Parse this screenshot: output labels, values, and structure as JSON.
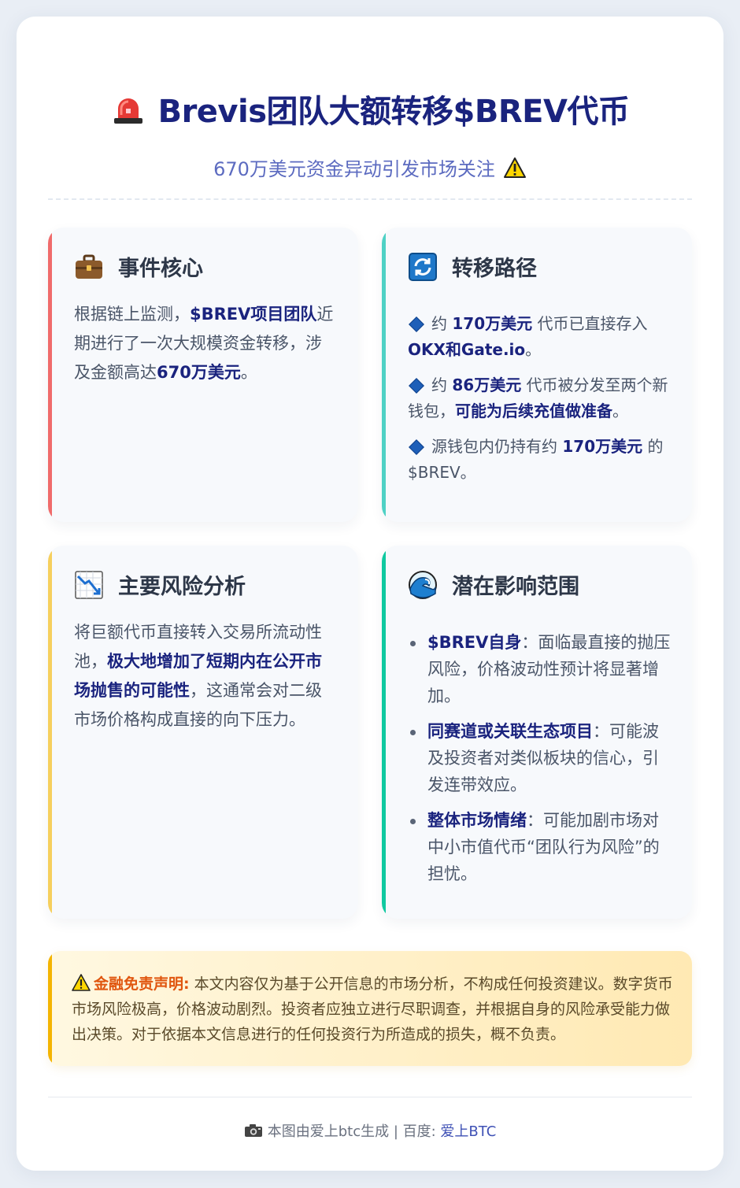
{
  "header": {
    "title": "Brevis团队大额转移$BREV代币",
    "subtitle": "670万美元资金异动引发市场关注"
  },
  "panels": {
    "core": {
      "title": "事件核心",
      "icon": "briefcase-icon",
      "body": {
        "t1": "根据链上监测，",
        "h1": "$BREV项目团队",
        "t2": "近期进行了一次大规模资金转移，涉及金额高达",
        "h2": "670万美元",
        "t3": "。"
      }
    },
    "route": {
      "title": "转移路径",
      "icon": "refresh-icon",
      "items": [
        {
          "t1": "约 ",
          "h1": "170万美元",
          "t2": " 代币已直接存入 ",
          "h2": "OKX和Gate.io",
          "t3": "。"
        },
        {
          "t1": "约 ",
          "h1": "86万美元",
          "t2": " 代币被分发至两个新钱包，",
          "h2": "可能为后续充值做准备",
          "t3": "。"
        },
        {
          "t1": "源钱包内仍持有约 ",
          "h1": "170万美元",
          "t2": " 的 $BREV。"
        }
      ]
    },
    "risk": {
      "title": "主要风险分析",
      "icon": "chart-decreasing-icon",
      "body": {
        "t1": "将巨额代币直接转入交易所流动性池，",
        "h1": "极大地增加了短期内在公开市场抛售的可能性",
        "t2": "，这通常会对二级市场价格构成直接的向下压力。"
      }
    },
    "impact": {
      "title": "潜在影响范围",
      "icon": "wave-icon",
      "items": [
        {
          "h": "$BREV自身",
          "t": "：面临最直接的抛压风险，价格波动性预计将显著增加。"
        },
        {
          "h": "同赛道或关联生态项目",
          "t": "：可能波及投资者对类似板块的信心，引发连带效应。"
        },
        {
          "h": "整体市场情绪",
          "t": "：可能加剧市场对中小市值代币“团队行为风险”的担忧。"
        }
      ]
    }
  },
  "disclaimer": {
    "label": "金融免责声明:",
    "text": " 本文内容仅为基于公开信息的市场分析，不构成任何投资建议。数字货币市场风险极高，价格波动剧烈。投资者应独立进行尽职调查，并根据自身的风险承受能力做出决策。对于依据本文信息进行的任何投资行为所造成的损失，概不负责。"
  },
  "footer": {
    "text": "本图由爱上btc生成 | 百度: ",
    "brand": "爱上BTC"
  },
  "colors": {
    "title": "#1a237e",
    "subtitle": "#5c6bc0",
    "accent_red": "#f06b6b",
    "accent_teal": "#4fd1c5",
    "accent_yellow": "#f6cf5d",
    "accent_green": "#10c9a0",
    "disclaimer_label": "#e0560f"
  }
}
